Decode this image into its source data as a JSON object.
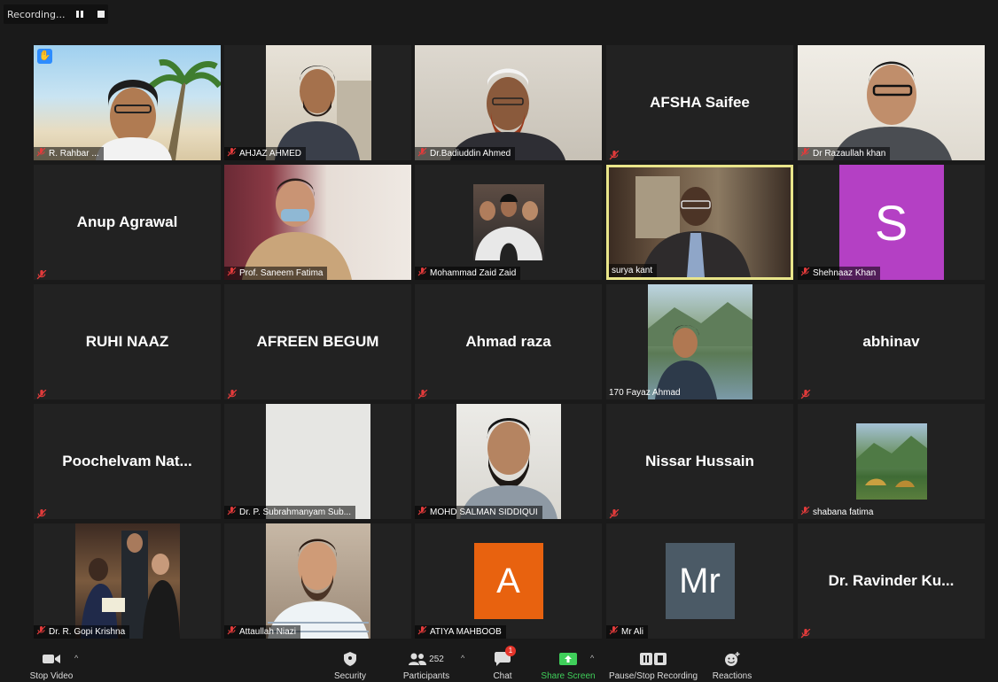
{
  "recording": {
    "label": "Recording...",
    "pause_icon": "pause-icon",
    "stop_icon": "stop-icon"
  },
  "tiles": [
    {
      "name": "R. Rahbar ...",
      "type": "video",
      "muted": true,
      "raised_hand": true
    },
    {
      "name": "AHJAZ AHMED",
      "type": "video",
      "muted": true
    },
    {
      "name": "Dr.Badiuddin Ahmed",
      "type": "video",
      "muted": true
    },
    {
      "name": "AFSHA Saifee",
      "type": "name",
      "muted": true
    },
    {
      "name": "Dr Razaullah khan",
      "type": "video",
      "muted": true
    },
    {
      "name": "Anup Agrawal",
      "type": "name",
      "muted": true
    },
    {
      "name": "Prof. Saneem Fatima",
      "type": "video",
      "muted": true
    },
    {
      "name": "Mohammad Zaid Zaid",
      "type": "video",
      "muted": true
    },
    {
      "name": "surya kant",
      "type": "video",
      "muted": false,
      "active_speaker": true
    },
    {
      "name": "Shehnaaz Khan",
      "type": "avatar",
      "avatar_letter": "S",
      "avatar_color": "#b440c4",
      "muted": true
    },
    {
      "name": "RUHI NAAZ",
      "type": "name",
      "muted": true
    },
    {
      "name": "AFREEN BEGUM",
      "type": "name",
      "muted": true
    },
    {
      "name": "Ahmad raza",
      "type": "name",
      "muted": true
    },
    {
      "name": "170 Fayaz Ahmad",
      "type": "video",
      "muted": false
    },
    {
      "name": "abhinav",
      "type": "name",
      "muted": true
    },
    {
      "name": "Poochelvam  Nat...",
      "type": "name",
      "muted": true
    },
    {
      "name": "Dr. P. Subrahmanyam Sub...",
      "type": "video",
      "muted": true
    },
    {
      "name": "MOHD SALMAN SIDDIQUI",
      "type": "video",
      "muted": true
    },
    {
      "name": "Nissar Hussain",
      "type": "name",
      "muted": true
    },
    {
      "name": "shabana fatima",
      "type": "video",
      "muted": true
    },
    {
      "name": "Dr. R. Gopi Krishna",
      "type": "video",
      "muted": true
    },
    {
      "name": "Attaullah Niazi",
      "type": "video",
      "muted": true
    },
    {
      "name": "ATIYA MAHBOOB",
      "type": "avatar",
      "avatar_letter": "A",
      "avatar_color": "#e8620f",
      "muted": true
    },
    {
      "name": "Mr Ali",
      "type": "avatar",
      "avatar_letter": "Mr",
      "avatar_color": "#4b5a66",
      "muted": true
    },
    {
      "name": "Dr. Ravinder Ku...",
      "type": "name",
      "muted": true
    }
  ],
  "toolbar": {
    "stop_video": "Stop Video",
    "security": "Security",
    "participants": "Participants",
    "participants_count": "252",
    "chat": "Chat",
    "chat_badge": "1",
    "share_screen": "Share Screen",
    "pause_stop_recording": "Pause/Stop Recording",
    "reactions": "Reactions",
    "share_color": "#3fcf5a"
  }
}
